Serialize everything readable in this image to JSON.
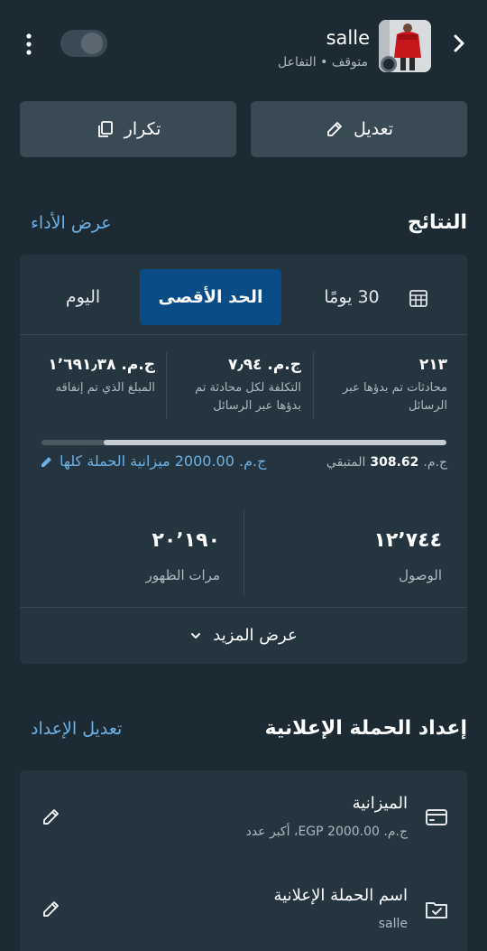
{
  "header": {
    "campaign_name": "salle",
    "status": "متوقف • التفاعل",
    "icons": {
      "back": "chevron-right-icon",
      "more": "more-vertical-icon"
    },
    "toggle_on": false
  },
  "actions": {
    "edit_label": "تعديل",
    "duplicate_label": "تكرار"
  },
  "results": {
    "title": "النتائج",
    "view_performance": "عرض الأداء",
    "tabs": [
      {
        "label": "30 يومًا",
        "active": false
      },
      {
        "label": "الحد الأقصى",
        "active": true
      },
      {
        "label": "اليوم",
        "active": false
      }
    ],
    "metrics": [
      {
        "value": "٢١٣",
        "label": "محادثات تم بدؤها عبر الرسائل"
      },
      {
        "value": "ج.م. ٧٫٩٤",
        "label": "التكلفة لكل محادثة تم بدؤها عبر الرسائل"
      },
      {
        "value": "ج.م. ١٬٦٩١٫٣٨",
        "label": "المبلغ الذي تم إنفاقه"
      }
    ],
    "budget": {
      "remaining_label": "المتبقي",
      "remaining_value": "308.62",
      "currency": "ج.م.",
      "total_text": "ج.م. 2000.00 ميزانية الحملة كلها",
      "spent_fraction": 0.846
    },
    "reach": {
      "value": "١٢٬٧٤٤",
      "label": "الوصول"
    },
    "impressions": {
      "value": "٢٠٬١٩٠",
      "label": "مرات الظهور"
    },
    "see_more": "عرض المزيد"
  },
  "setup": {
    "title": "إعداد الحملة الإعلانية",
    "edit_setup": "تعديل الإعداد",
    "rows": [
      {
        "title": "الميزانية",
        "subtitle": "ج.م. EGP 2000.00، أكبر عدد",
        "icon": "credit-card-icon"
      },
      {
        "title": "اسم الحملة الإعلانية",
        "subtitle": "salle",
        "icon": "folder-check-icon"
      }
    ]
  },
  "colors": {
    "background": "#1c2b33",
    "card": "#243540",
    "accent_tab": "#0a4c87",
    "link": "#6fb0e4"
  }
}
